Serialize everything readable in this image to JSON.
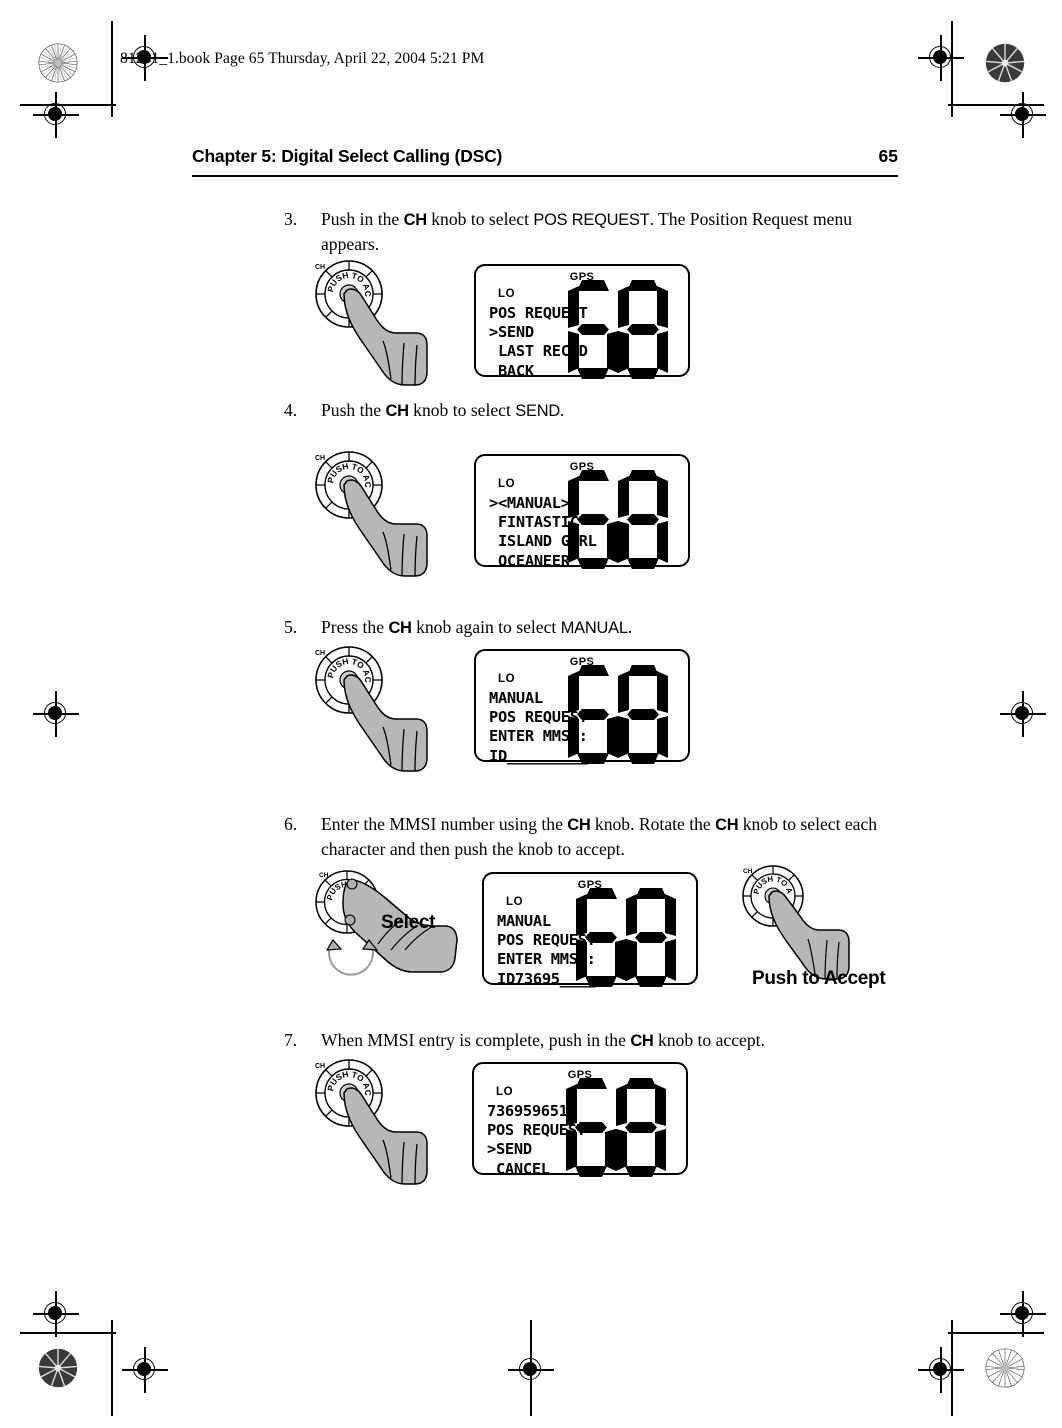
{
  "printer_marks": {
    "filestamp": "81231_1.book  Page 65  Thursday, April 22, 2004  5:21 PM"
  },
  "running_head": {
    "title": "Chapter 5: Digital Select Calling (DSC)",
    "page_number": "65"
  },
  "knob": {
    "channel_label": "CH",
    "ring_text": "PUSH TO ACCEPT"
  },
  "callouts": {
    "select": "Select",
    "push_to_accept": "Push to Accept"
  },
  "steps": [
    {
      "number": "3.",
      "text_parts": [
        {
          "t": "Push in the ",
          "style": "serif"
        },
        {
          "t": "CH",
          "style": "ch"
        },
        {
          "t": " knob to select ",
          "style": "serif"
        },
        {
          "t": "POS REQUEST",
          "style": "sans"
        },
        {
          "t": ". The Position Request menu appears.",
          "style": "serif"
        }
      ]
    },
    {
      "number": "4.",
      "text_parts": [
        {
          "t": "Push the ",
          "style": "serif"
        },
        {
          "t": "CH",
          "style": "ch"
        },
        {
          "t": " knob to select ",
          "style": "serif"
        },
        {
          "t": "SEND",
          "style": "sans"
        },
        {
          "t": ".",
          "style": "serif"
        }
      ]
    },
    {
      "number": "5.",
      "text_parts": [
        {
          "t": "Press the ",
          "style": "serif"
        },
        {
          "t": "CH",
          "style": "ch"
        },
        {
          "t": " knob again to select ",
          "style": "serif"
        },
        {
          "t": "MANUAL",
          "style": "sans"
        },
        {
          "t": ".",
          "style": "serif"
        }
      ]
    },
    {
      "number": "6.",
      "text_parts": [
        {
          "t": "Enter the MMSI number using the ",
          "style": "serif"
        },
        {
          "t": "CH",
          "style": "ch"
        },
        {
          "t": " knob. Rotate the ",
          "style": "serif"
        },
        {
          "t": "CH",
          "style": "ch"
        },
        {
          "t": " knob to select each character and then push the knob to accept.",
          "style": "serif"
        }
      ]
    },
    {
      "number": "7.",
      "text_parts": [
        {
          "t": "When MMSI entry is complete, push in the ",
          "style": "serif"
        },
        {
          "t": "CH",
          "style": "ch"
        },
        {
          "t": " knob to accept.",
          "style": "serif"
        }
      ]
    }
  ],
  "displays": [
    {
      "id": "lcd-step3",
      "gps": "GPS",
      "lo": "LO",
      "channel": "68",
      "lines": "POS REQUEST\n>SEND\n LAST RECVD\n BACK"
    },
    {
      "id": "lcd-step4",
      "gps": "GPS",
      "lo": "LO",
      "channel": "68",
      "lines": "><MANUAL>\n FINTASTIC\n ISLAND GIRL\n OCEANEER"
    },
    {
      "id": "lcd-step5",
      "gps": "GPS",
      "lo": "LO",
      "channel": "68",
      "lines": "MANUAL\nPOS REQUEST\nENTER MMSI:\nID_________"
    },
    {
      "id": "lcd-step6",
      "gps": "GPS",
      "lo": "LO",
      "channel": "68",
      "lines": "MANUAL\nPOS REQUEST\nENTER MMSI:\nID73695____"
    },
    {
      "id": "lcd-step7",
      "gps": "GPS",
      "lo": "LO",
      "channel": "68",
      "lines": "736959651\nPOS REQUEST\n>SEND\n CANCEL"
    }
  ]
}
